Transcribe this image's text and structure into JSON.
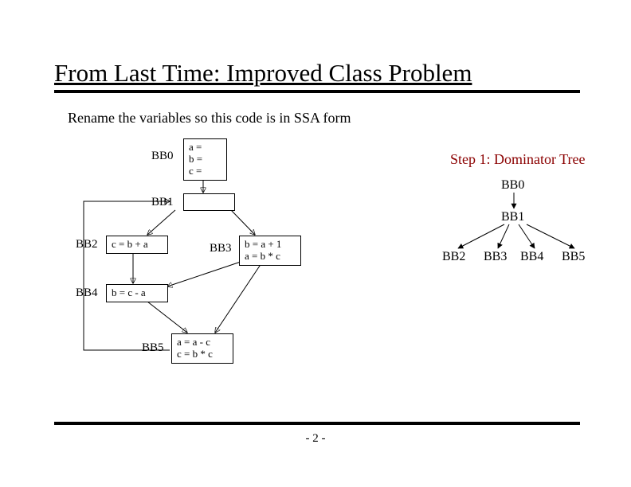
{
  "title": "From Last Time: Improved Class Problem",
  "subtitle": "Rename the variables so this code is in SSA form",
  "step_title": "Step 1: Dominator Tree",
  "page_number": "- 2 -",
  "flow": {
    "labels": {
      "bb0": "BB0",
      "bb1": "BB1",
      "bb2": "BB2",
      "bb3": "BB3",
      "bb4": "BB4",
      "bb5": "BB5"
    },
    "content": {
      "bb0_l1": "a =",
      "bb0_l2": "b =",
      "bb0_l3": "c =",
      "bb2": "c = b + a",
      "bb3_l1": "b = a + 1",
      "bb3_l2": "a = b * c",
      "bb4": "b = c - a",
      "bb5_l1": "a = a - c",
      "bb5_l2": "c = b * c"
    }
  },
  "dom_tree": {
    "nodes": {
      "bb0": "BB0",
      "bb1": "BB1",
      "bb2": "BB2",
      "bb3": "BB3",
      "bb4": "BB4",
      "bb5": "BB5"
    }
  }
}
